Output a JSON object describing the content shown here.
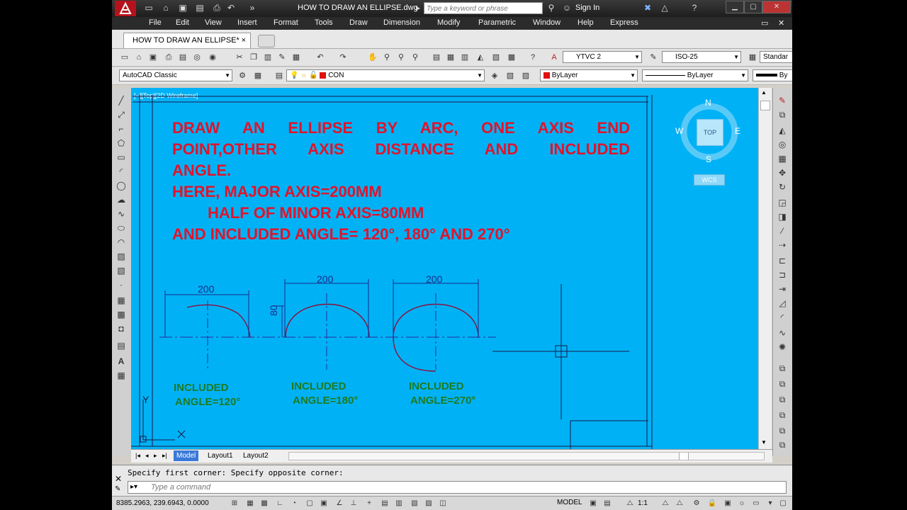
{
  "app": {
    "title": "HOW TO DRAW AN ELLIPSE.dwg",
    "search_placeholder": "Type a keyword or phrase",
    "sign_in": "Sign In"
  },
  "menu": [
    "File",
    "Edit",
    "View",
    "Insert",
    "Format",
    "Tools",
    "Draw",
    "Dimension",
    "Modify",
    "Parametric",
    "Window",
    "Help",
    "Express"
  ],
  "doc_tab": {
    "label": "HOW TO DRAW AN ELLIPSE*",
    "close": "×"
  },
  "toolbar1": {
    "text_style": "YTVC 2",
    "dim_style": "ISO-25",
    "table_style": "Standar"
  },
  "toolbar2": {
    "workspace": "AutoCAD Classic",
    "layer": "CON",
    "color": "ByLayer",
    "linetype": "ByLayer",
    "lineweight": "By"
  },
  "viewport": {
    "label": "[−][Top][2D Wireframe]"
  },
  "viewcube": {
    "n": "N",
    "s": "S",
    "e": "E",
    "w": "W",
    "top": "TOP",
    "wcs": "WCS"
  },
  "heading": {
    "line1": "DRAW AN ELLIPSE BY ARC, ONE AXIS END",
    "line2": "POINT,OTHER AXIS DISTANCE AND INCLUDED",
    "line3": "ANGLE.",
    "line4": "HERE,  MAJOR AXIS=200MM",
    "line5": "HALF OF MINOR AXIS=80MM",
    "line6": "AND INCLUDED ANGLE= 120°, 180° AND 270°"
  },
  "figures": {
    "dim1": "200",
    "dim2": "200",
    "dim3": "200",
    "minor": "80",
    "label1a": "INCLUDED",
    "label1b": "ANGLE=120°",
    "label2a": "INCLUDED",
    "label2b": "ANGLE=180°",
    "label3a": "INCLUDED",
    "label3b": "ANGLE=270°",
    "ucs_y": "Y"
  },
  "layout_tabs": [
    "Model",
    "Layout1",
    "Layout2"
  ],
  "command": {
    "history": "Specify first corner: Specify opposite corner:",
    "placeholder": "Type a command"
  },
  "status": {
    "coords": "8385.2963, 239.6943, 0.0000",
    "model": "MODEL",
    "scale": "1:1"
  },
  "colors": {
    "background": "#00b2f5",
    "heading": "#e0142c",
    "labels": "#1f7a1f",
    "dimension": "#1d2a8a",
    "curve": "#8a1040"
  }
}
